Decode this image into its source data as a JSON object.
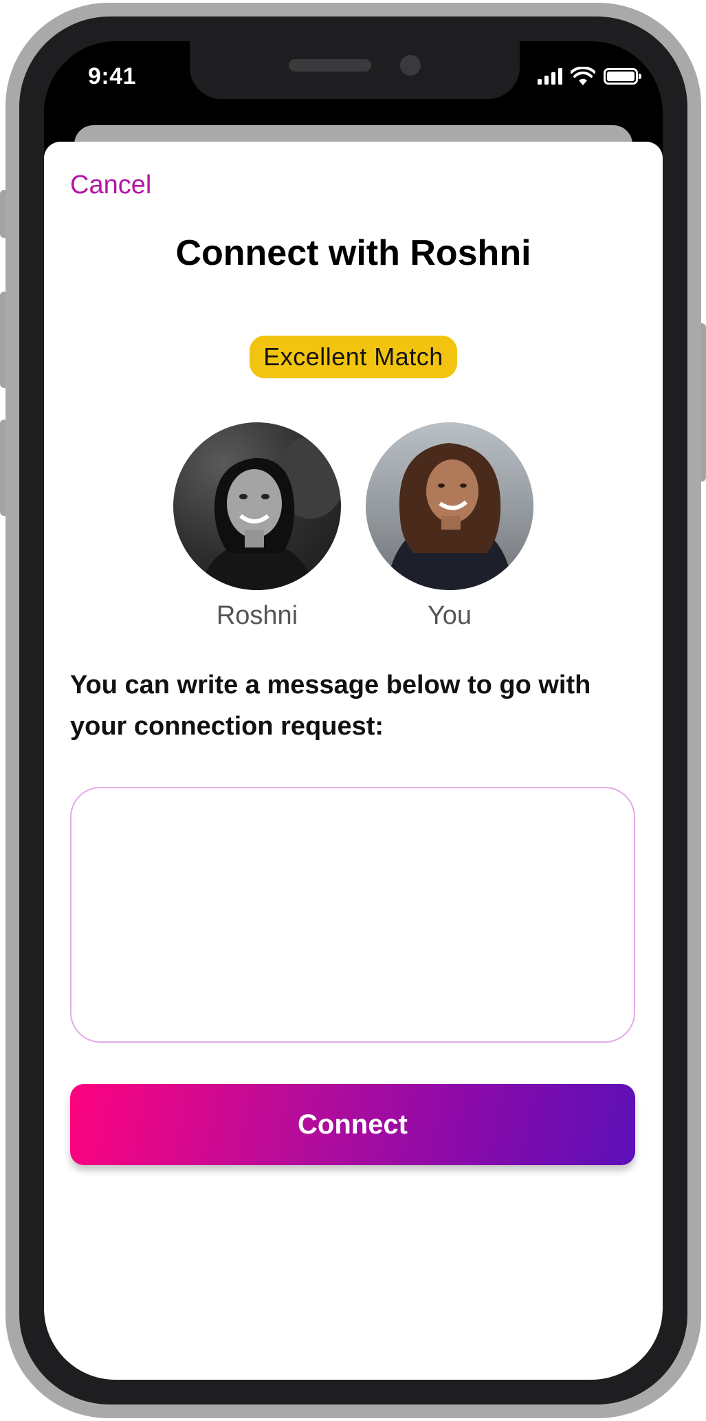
{
  "status_bar": {
    "time": "9:41",
    "icons": [
      "signal-icon",
      "wifi-icon",
      "battery-icon"
    ]
  },
  "sheet": {
    "cancel_label": "Cancel",
    "title": "Connect with Roshni",
    "badge_label": "Excellent Match",
    "avatars": [
      {
        "name": "Roshni"
      },
      {
        "name": "You"
      }
    ],
    "prompt": "You can write a message below to go with your connection request:",
    "message_value": "",
    "connect_label": "Connect"
  },
  "colors": {
    "accent": "#b217a6",
    "badge": "#f2c40f",
    "button_gradient_start": "#fd037f",
    "button_gradient_end": "#5c10b8",
    "input_border": "#e3a9e6"
  }
}
